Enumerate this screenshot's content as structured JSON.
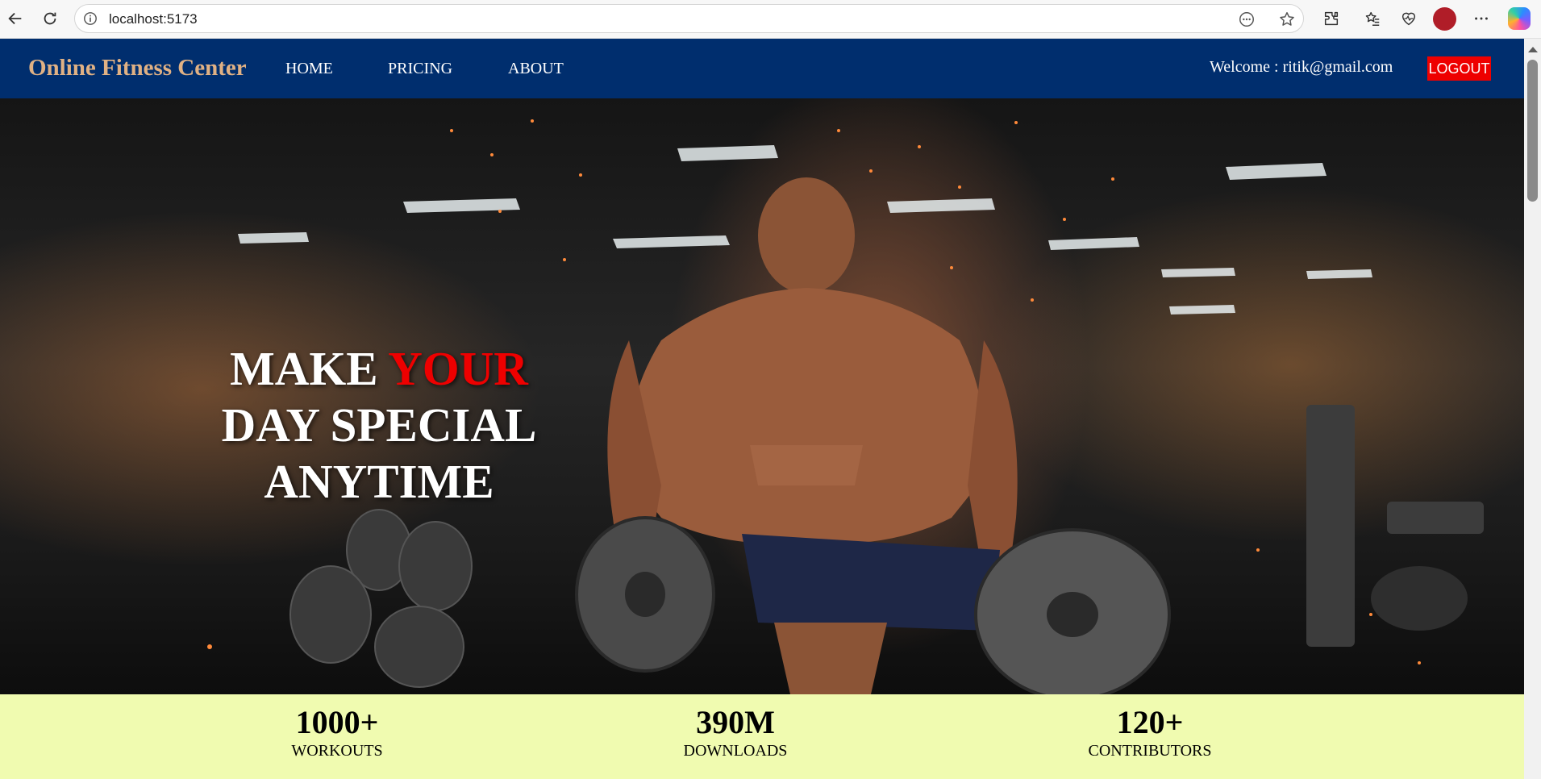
{
  "browser": {
    "url": "localhost:5173",
    "icons": [
      "back-arrow-icon",
      "reload-icon",
      "site-info-icon",
      "read-aloud-icon",
      "favorite-star-icon",
      "extensions-icon",
      "favorites-icon",
      "browser-essentials-icon",
      "profile-avatar",
      "more-menu-icon",
      "copilot-icon"
    ],
    "accent": "#b01d28"
  },
  "nav": {
    "brand": "Online Fitness Center",
    "links": [
      "HOME",
      "PRICING",
      "ABOUT"
    ],
    "welcome": "Welcome : ritik@gmail.com",
    "logout": "LOGOUT",
    "colors": {
      "bar": "#002e6e",
      "brand": "#e0b184",
      "logout": "#ee0000"
    }
  },
  "hero": {
    "line1_a": "MAKE ",
    "line1_b": "YOUR",
    "line2": "DAY SPECIAL",
    "line3": "ANYTIME",
    "accent_color": "#ee0000"
  },
  "stats": [
    {
      "value": "1000+",
      "label": "WORKOUTS"
    },
    {
      "value": "390M",
      "label": "DOWNLOADS"
    },
    {
      "value": "120+",
      "label": "CONTRIBUTORS"
    }
  ],
  "stats_background": "#f0fbb0"
}
